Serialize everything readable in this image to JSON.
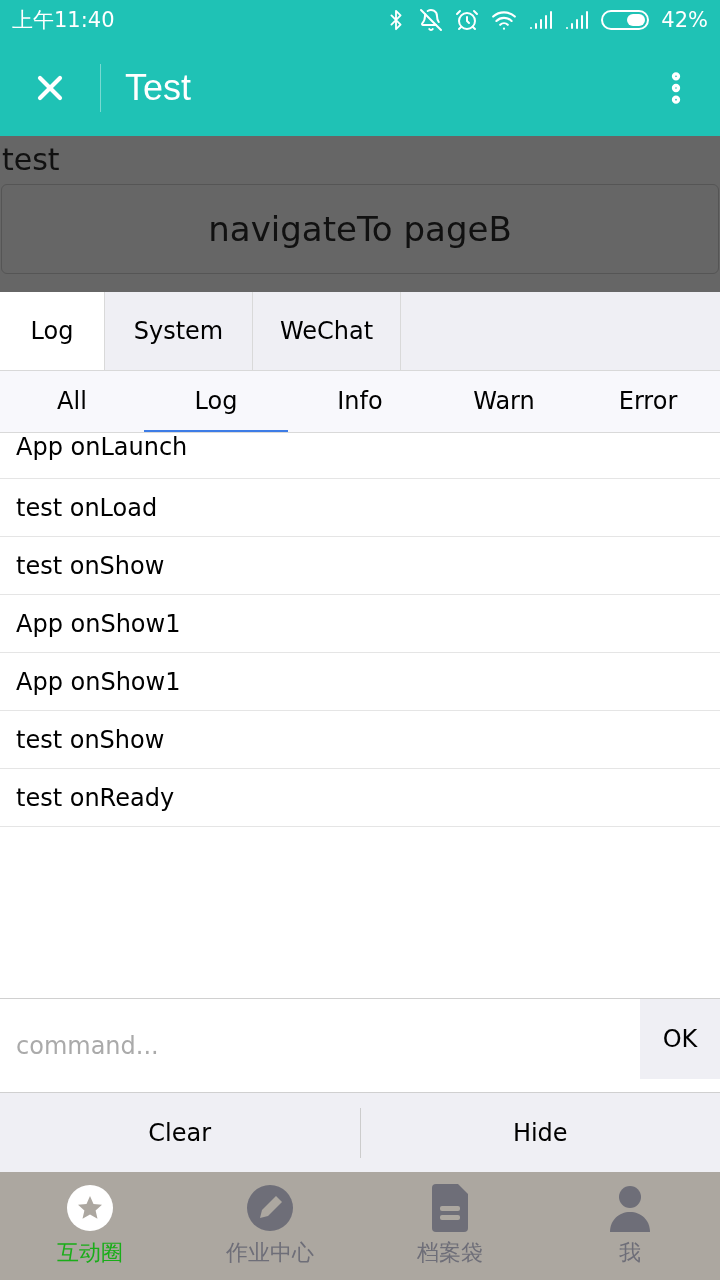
{
  "status_bar": {
    "time": "上午11:40",
    "battery": "42%"
  },
  "nav_bar": {
    "title": "Test"
  },
  "page": {
    "heading": "test",
    "button": "navigateTo pageB"
  },
  "console": {
    "tabs": [
      {
        "label": "Log",
        "selected": true
      },
      {
        "label": "System",
        "selected": false
      },
      {
        "label": "WeChat",
        "selected": false
      }
    ],
    "filters": [
      {
        "label": "All",
        "selected": false
      },
      {
        "label": "Log",
        "selected": true
      },
      {
        "label": "Info",
        "selected": false
      },
      {
        "label": "Warn",
        "selected": false
      },
      {
        "label": "Error",
        "selected": false
      }
    ],
    "logs": [
      "App onLaunch",
      "test onLoad",
      "test onShow",
      "App onShow1",
      "App onShow1",
      "test onShow",
      "test onReady"
    ],
    "command": {
      "placeholder": "command...",
      "button": "OK"
    },
    "actions": [
      "Clear",
      "Hide"
    ]
  },
  "tab_bar": [
    {
      "label": "互动圈",
      "kind": "star",
      "selected": true
    },
    {
      "label": "作业中心",
      "kind": "pencil",
      "selected": false
    },
    {
      "label": "档案袋",
      "kind": "file",
      "selected": false
    },
    {
      "label": "我",
      "kind": "user",
      "selected": false
    }
  ]
}
